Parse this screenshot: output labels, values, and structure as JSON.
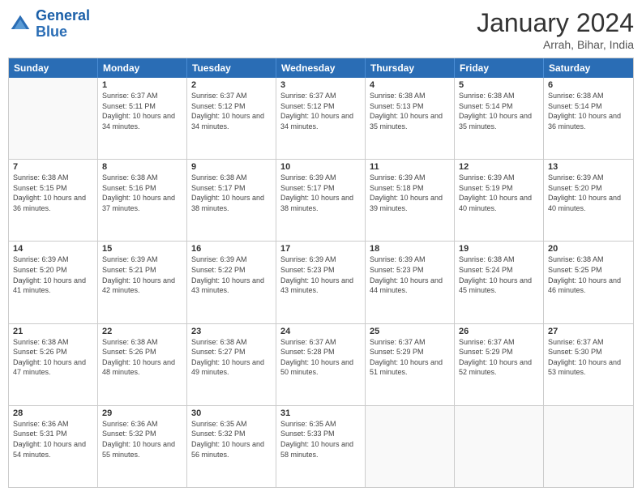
{
  "header": {
    "logo_line1": "General",
    "logo_line2": "Blue",
    "month": "January 2024",
    "location": "Arrah, Bihar, India"
  },
  "days_of_week": [
    "Sunday",
    "Monday",
    "Tuesday",
    "Wednesday",
    "Thursday",
    "Friday",
    "Saturday"
  ],
  "weeks": [
    [
      {
        "day": "",
        "info": ""
      },
      {
        "day": "1",
        "info": "Sunrise: 6:37 AM\nSunset: 5:11 PM\nDaylight: 10 hours and 34 minutes."
      },
      {
        "day": "2",
        "info": "Sunrise: 6:37 AM\nSunset: 5:12 PM\nDaylight: 10 hours and 34 minutes."
      },
      {
        "day": "3",
        "info": "Sunrise: 6:37 AM\nSunset: 5:12 PM\nDaylight: 10 hours and 34 minutes."
      },
      {
        "day": "4",
        "info": "Sunrise: 6:38 AM\nSunset: 5:13 PM\nDaylight: 10 hours and 35 minutes."
      },
      {
        "day": "5",
        "info": "Sunrise: 6:38 AM\nSunset: 5:14 PM\nDaylight: 10 hours and 35 minutes."
      },
      {
        "day": "6",
        "info": "Sunrise: 6:38 AM\nSunset: 5:14 PM\nDaylight: 10 hours and 36 minutes."
      }
    ],
    [
      {
        "day": "7",
        "info": "Sunrise: 6:38 AM\nSunset: 5:15 PM\nDaylight: 10 hours and 36 minutes."
      },
      {
        "day": "8",
        "info": "Sunrise: 6:38 AM\nSunset: 5:16 PM\nDaylight: 10 hours and 37 minutes."
      },
      {
        "day": "9",
        "info": "Sunrise: 6:38 AM\nSunset: 5:17 PM\nDaylight: 10 hours and 38 minutes."
      },
      {
        "day": "10",
        "info": "Sunrise: 6:39 AM\nSunset: 5:17 PM\nDaylight: 10 hours and 38 minutes."
      },
      {
        "day": "11",
        "info": "Sunrise: 6:39 AM\nSunset: 5:18 PM\nDaylight: 10 hours and 39 minutes."
      },
      {
        "day": "12",
        "info": "Sunrise: 6:39 AM\nSunset: 5:19 PM\nDaylight: 10 hours and 40 minutes."
      },
      {
        "day": "13",
        "info": "Sunrise: 6:39 AM\nSunset: 5:20 PM\nDaylight: 10 hours and 40 minutes."
      }
    ],
    [
      {
        "day": "14",
        "info": "Sunrise: 6:39 AM\nSunset: 5:20 PM\nDaylight: 10 hours and 41 minutes."
      },
      {
        "day": "15",
        "info": "Sunrise: 6:39 AM\nSunset: 5:21 PM\nDaylight: 10 hours and 42 minutes."
      },
      {
        "day": "16",
        "info": "Sunrise: 6:39 AM\nSunset: 5:22 PM\nDaylight: 10 hours and 43 minutes."
      },
      {
        "day": "17",
        "info": "Sunrise: 6:39 AM\nSunset: 5:23 PM\nDaylight: 10 hours and 43 minutes."
      },
      {
        "day": "18",
        "info": "Sunrise: 6:39 AM\nSunset: 5:23 PM\nDaylight: 10 hours and 44 minutes."
      },
      {
        "day": "19",
        "info": "Sunrise: 6:38 AM\nSunset: 5:24 PM\nDaylight: 10 hours and 45 minutes."
      },
      {
        "day": "20",
        "info": "Sunrise: 6:38 AM\nSunset: 5:25 PM\nDaylight: 10 hours and 46 minutes."
      }
    ],
    [
      {
        "day": "21",
        "info": "Sunrise: 6:38 AM\nSunset: 5:26 PM\nDaylight: 10 hours and 47 minutes."
      },
      {
        "day": "22",
        "info": "Sunrise: 6:38 AM\nSunset: 5:26 PM\nDaylight: 10 hours and 48 minutes."
      },
      {
        "day": "23",
        "info": "Sunrise: 6:38 AM\nSunset: 5:27 PM\nDaylight: 10 hours and 49 minutes."
      },
      {
        "day": "24",
        "info": "Sunrise: 6:37 AM\nSunset: 5:28 PM\nDaylight: 10 hours and 50 minutes."
      },
      {
        "day": "25",
        "info": "Sunrise: 6:37 AM\nSunset: 5:29 PM\nDaylight: 10 hours and 51 minutes."
      },
      {
        "day": "26",
        "info": "Sunrise: 6:37 AM\nSunset: 5:29 PM\nDaylight: 10 hours and 52 minutes."
      },
      {
        "day": "27",
        "info": "Sunrise: 6:37 AM\nSunset: 5:30 PM\nDaylight: 10 hours and 53 minutes."
      }
    ],
    [
      {
        "day": "28",
        "info": "Sunrise: 6:36 AM\nSunset: 5:31 PM\nDaylight: 10 hours and 54 minutes."
      },
      {
        "day": "29",
        "info": "Sunrise: 6:36 AM\nSunset: 5:32 PM\nDaylight: 10 hours and 55 minutes."
      },
      {
        "day": "30",
        "info": "Sunrise: 6:35 AM\nSunset: 5:32 PM\nDaylight: 10 hours and 56 minutes."
      },
      {
        "day": "31",
        "info": "Sunrise: 6:35 AM\nSunset: 5:33 PM\nDaylight: 10 hours and 58 minutes."
      },
      {
        "day": "",
        "info": ""
      },
      {
        "day": "",
        "info": ""
      },
      {
        "day": "",
        "info": ""
      }
    ]
  ]
}
